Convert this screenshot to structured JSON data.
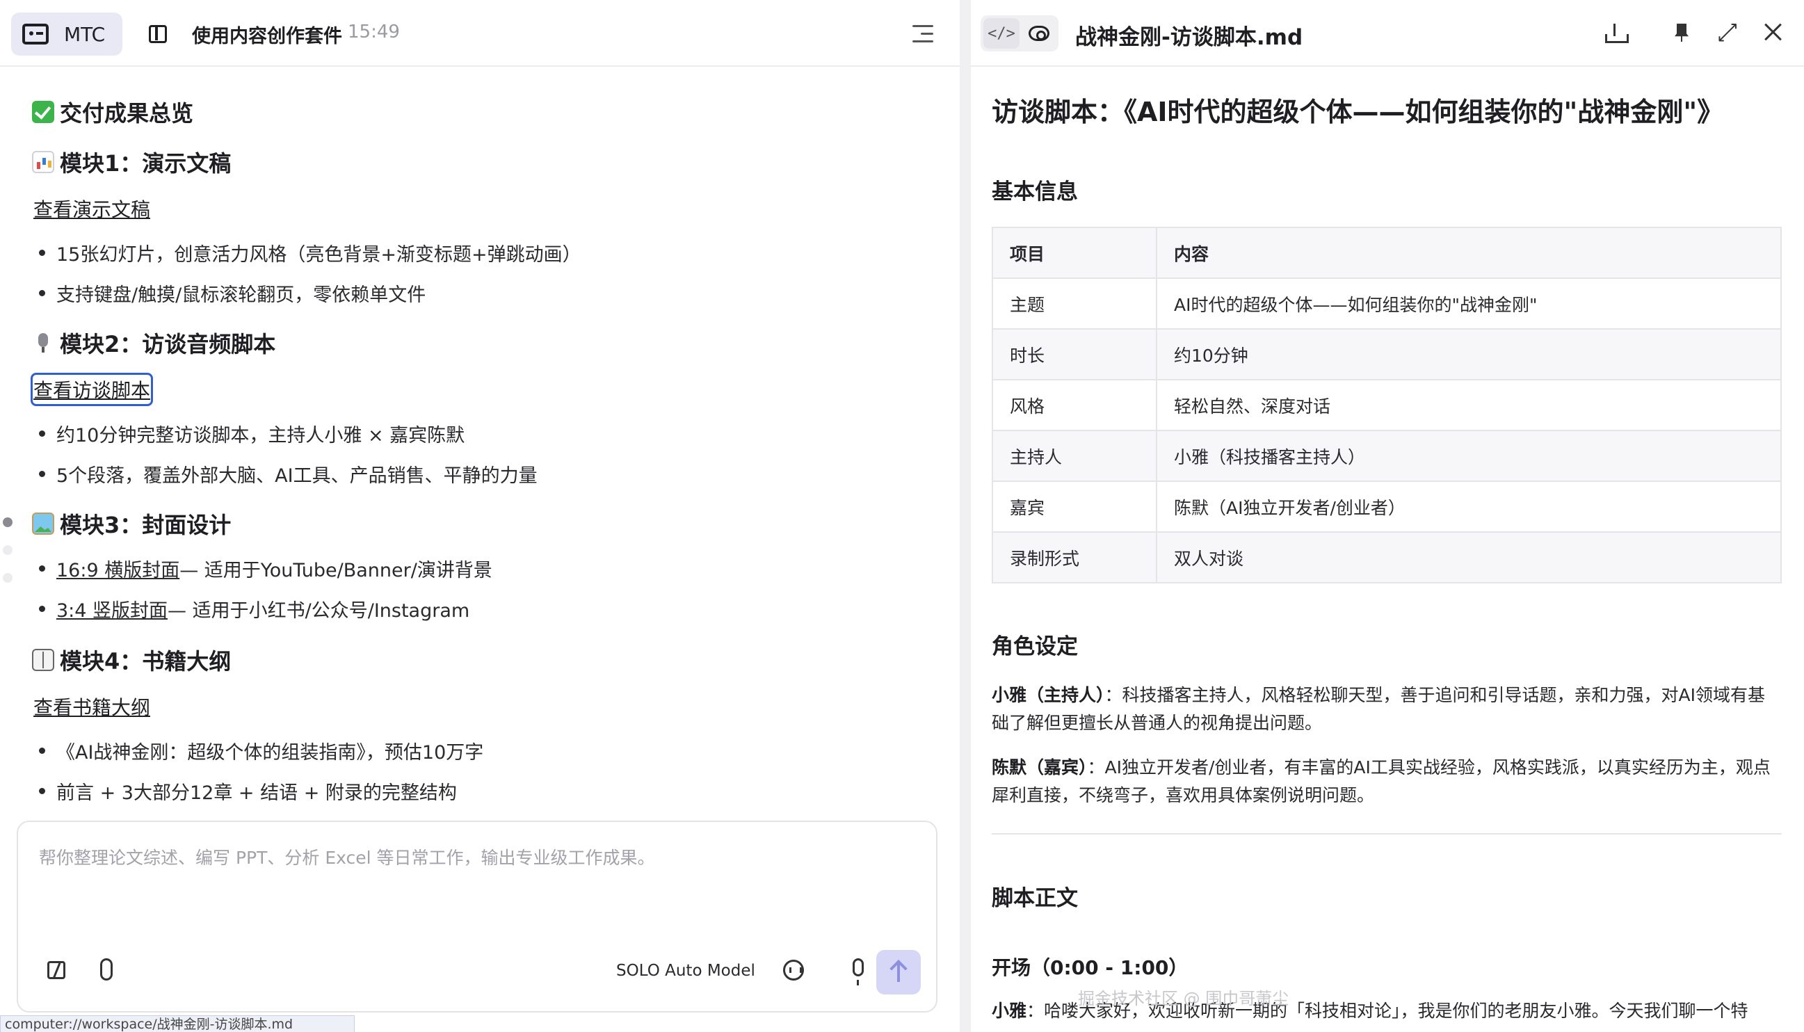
{
  "left_header": {
    "app_label": "MTC",
    "session_title": "使用内容创作套件",
    "session_time": "15:49"
  },
  "summary": {
    "title": "交付成果总览",
    "module1": {
      "title": "模块1：演示文稿",
      "link": "查看演示文稿",
      "bullets": [
        "15张幻灯片，创意活力风格（亮色背景+渐变标题+弹跳动画）",
        "支持键盘/触摸/鼠标滚轮翻页，零依赖单文件"
      ]
    },
    "module2": {
      "title": "模块2：访谈音频脚本",
      "link": "查看访谈脚本",
      "bullets": [
        "约10分钟完整访谈脚本，主持人小雅 × 嘉宾陈默",
        "5个段落，覆盖外部大脑、AI工具、产品销售、平静的力量"
      ]
    },
    "module3": {
      "title": "模块3：封面设计",
      "items": [
        {
          "link": "16:9 横版封面",
          "rest": " — 适用于YouTube/Banner/演讲背景"
        },
        {
          "link": "3:4 竖版封面",
          "rest": " — 适用于小红书/公众号/Instagram"
        }
      ]
    },
    "module4": {
      "title": "模块4：书籍大纲",
      "link": "查看书籍大纲",
      "bullets": [
        "《AI战神金刚：超级个体的组装指南》，预估10万字",
        "前言 + 3大部分12章 + 结语 + 附录的完整结构"
      ]
    }
  },
  "composer": {
    "placeholder": "帮你整理论文综述、编写 PPT、分析 Excel 等日常工作，输出专业级工作成果。",
    "model": "SOLO Auto Model"
  },
  "status_bar": {
    "url": "computer://workspace/战神金刚-访谈脚本.md"
  },
  "right_header": {
    "code_glyph": "</>",
    "file_name": "战神金刚-访谈脚本.md"
  },
  "doc": {
    "h1": "访谈脚本：《AI时代的超级个体——如何组装你的\"战神金刚\"》",
    "basic_info_heading": "基本信息",
    "table_headers": [
      "项目",
      "内容"
    ],
    "table_rows": [
      [
        "主题",
        "AI时代的超级个体——如何组装你的\"战神金刚\""
      ],
      [
        "时长",
        "约10分钟"
      ],
      [
        "风格",
        "轻松自然、深度对话"
      ],
      [
        "主持人",
        "小雅（科技播客主持人）"
      ],
      [
        "嘉宾",
        "陈默（AI独立开发者/创业者）"
      ],
      [
        "录制形式",
        "双人对谈"
      ]
    ],
    "roles_heading": "角色设定",
    "role1_name": "小雅（主持人）",
    "role1_desc": "：科技播客主持人，风格轻松聊天型，善于追问和引导话题，亲和力强，对AI领域有基础了解但更擅长从普通人的视角提出问题。",
    "role2_name": "陈默（嘉宾）",
    "role2_desc": "：AI独立开发者/创业者，有丰富的AI工具实战经验，风格实践派，以真实经历为主，观点犀利直接，不绕弯子，喜欢用具体案例说明问题。",
    "script_heading": "脚本正文",
    "opening_heading": "开场（0:00 - 1:00）",
    "opening_speaker": "小雅",
    "opening_line": "：哈喽大家好，欢迎收听新一期的「科技相对论」，我是你们的老朋友小雅。今天我们聊一个特"
  },
  "watermark": "掘金技术社区 @ 围巾哥萧尘"
}
